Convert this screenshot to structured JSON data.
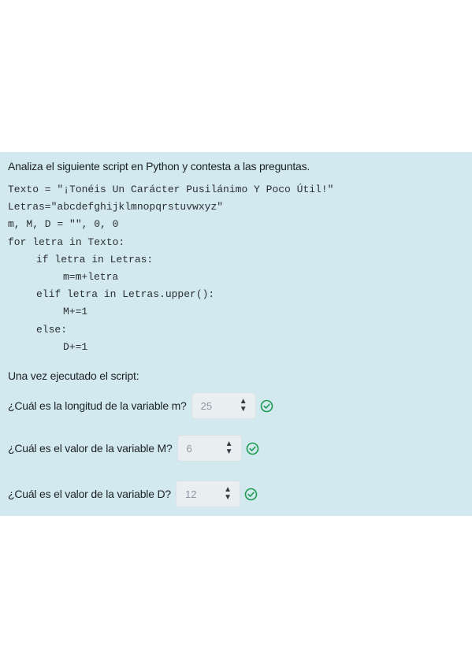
{
  "question": {
    "prompt": "Analiza el siguiente script en Python y contesta a las preguntas.",
    "code_lines": [
      "Texto = \"¡Tonéis Un Carácter Pusilánimo Y Poco Útil!\"",
      "Letras=\"abcdefghijklmnopqrstuvwxyz\"",
      "m, M, D = \"\", 0, 0",
      "for letra in Texto:",
      "if letra in Letras:",
      "m=m+letra",
      "elif letra in Letras.upper():",
      "M+=1",
      "else:",
      "D+=1"
    ],
    "after_run": "Una vez ejecutado el script:",
    "items": [
      {
        "label": "¿Cuál es la longitud de la variable m?",
        "value": "25",
        "status": "correct"
      },
      {
        "label": "¿Cuál es el valor de la variable M?",
        "value": "6",
        "status": "correct"
      },
      {
        "label": "¿Cuál es el valor de la variable D?",
        "value": "12",
        "status": "correct"
      }
    ]
  },
  "colors": {
    "panel_background": "#d1e9ef",
    "correct_icon": "#1e9b50"
  },
  "icons": {
    "select_arrows": "sort-arrows-icon",
    "correct": "check-circle-icon"
  }
}
